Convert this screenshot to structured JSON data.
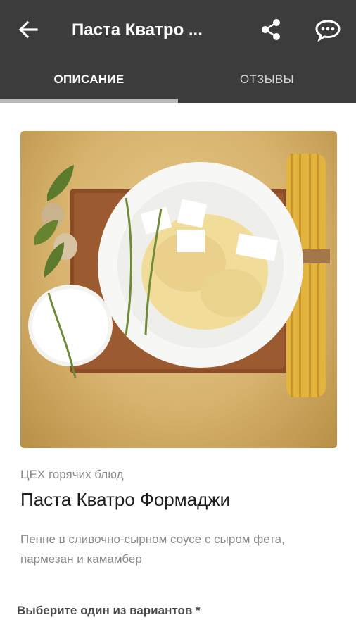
{
  "toolbar": {
    "title": "Паста Кватро ...",
    "icons": [
      "back-arrow-icon",
      "share-icon",
      "chat-icon"
    ]
  },
  "tabs": [
    {
      "label": "ОПИСАНИЕ",
      "active": true
    },
    {
      "label": "ОТЗЫВЫ",
      "active": false
    }
  ],
  "product": {
    "category": "ЦЕХ горячих блюд",
    "name": "Паста Кватро Формаджи",
    "description": "Пенне в сливочно-сырном соусе с сыром фета, пармезан и камамбер"
  },
  "options": {
    "label": "Выберите один из вариантов *"
  },
  "colors": {
    "appbar": "#3c3c3c",
    "tab_indicator": "#b9b9b9",
    "background": "#ffffff"
  }
}
